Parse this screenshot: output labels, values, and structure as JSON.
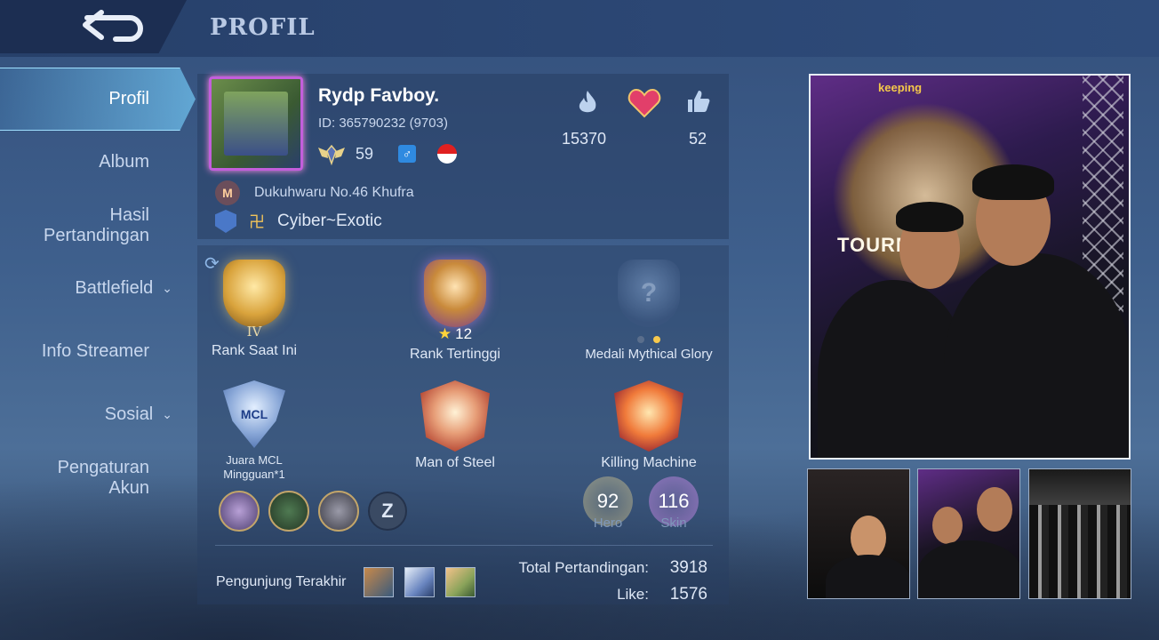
{
  "header": {
    "title": "PROFIL"
  },
  "sidebar": {
    "items": [
      {
        "label": "Profil"
      },
      {
        "label": "Album"
      },
      {
        "label": "Hasil Pertandingan"
      },
      {
        "label": "Battlefield"
      },
      {
        "label": "Info Streamer"
      },
      {
        "label": "Sosial"
      },
      {
        "label": "Pengaturan Akun"
      }
    ]
  },
  "player": {
    "name": "Rydp Favboy.",
    "id": "ID:  365790232 (9703)",
    "level": "59",
    "gender_symbol": "♂",
    "popularity": "15370",
    "likes_top": "52",
    "squad": "Dukuhwaru No.46 Khufra",
    "squad_badge": "M",
    "tag": "Cyiber~Exotic",
    "tag_glyph": "卍"
  },
  "medals": {
    "current_rank": {
      "label": "Rank Saat Ini",
      "roman": "IV"
    },
    "highest_rank": {
      "label": "Rank Tertinggi",
      "stars": "12"
    },
    "mythical_glory": {
      "label": "Medali Mythical Glory",
      "mark": "?"
    },
    "mcl": {
      "label_line1": "Juara MCL",
      "label_line2": "Mingguan*1",
      "badge_text": "MCL"
    },
    "man_of_steel": {
      "label": "Man of Steel"
    },
    "killing_machine": {
      "label": "Killing Machine"
    }
  },
  "collection": {
    "hero_count": "92",
    "hero_label": "Hero",
    "skin_count": "116",
    "skin_label": "Skin"
  },
  "visitors": {
    "label": "Pengunjung Terakhir"
  },
  "totals": {
    "matches_label": "Total Pertandingan:",
    "matches": "3918",
    "like_label": "Like:",
    "like": "1576"
  },
  "photo": {
    "poster_text": "TOURNA",
    "sponsor_text": "keeping"
  },
  "colors": {
    "accent": "#7fd0ff",
    "background": "#3e5f8c",
    "card": "#283e62"
  }
}
